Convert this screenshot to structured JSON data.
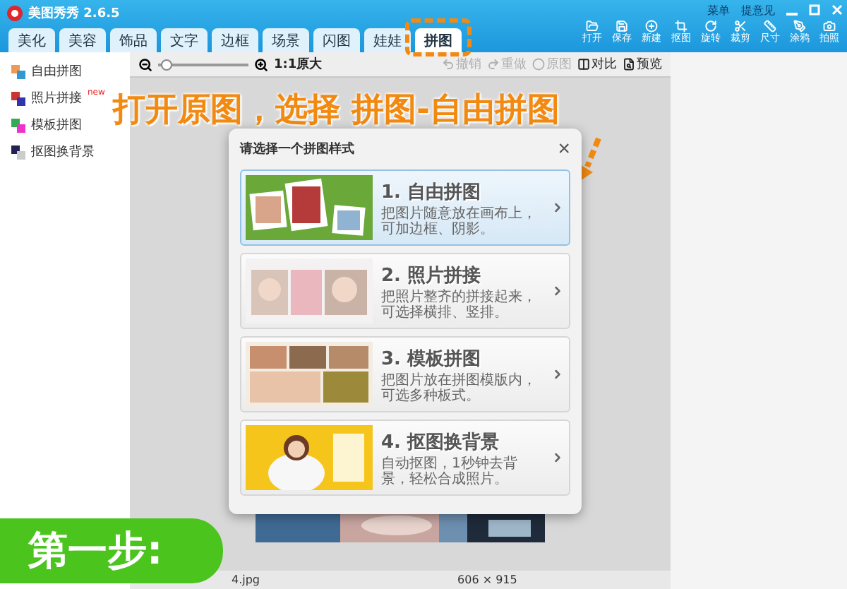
{
  "app": {
    "title": "美图秀秀 2.6.5",
    "links": [
      "菜单",
      "提意见"
    ]
  },
  "tabs": [
    {
      "label": "美化",
      "selected": false
    },
    {
      "label": "美容",
      "selected": false
    },
    {
      "label": "饰品",
      "selected": false
    },
    {
      "label": "文字",
      "selected": false
    },
    {
      "label": "边框",
      "selected": false
    },
    {
      "label": "场景",
      "selected": false
    },
    {
      "label": "闪图",
      "selected": false
    },
    {
      "label": "娃娃",
      "selected": false
    },
    {
      "label": "拼图",
      "selected": true
    }
  ],
  "tools": [
    "打开",
    "保存",
    "新建",
    "抠图",
    "旋转",
    "裁剪",
    "尺寸",
    "涂鸦",
    "拍照"
  ],
  "sidebar": [
    {
      "label": "自由拼图"
    },
    {
      "label": "照片拼接",
      "badge": "new"
    },
    {
      "label": "模板拼图"
    },
    {
      "label": "抠图换背景"
    }
  ],
  "toolbar": {
    "zoom": {
      "level": 0.03
    },
    "zoom_label": "1:1原大",
    "actions": [
      {
        "label": "撤销",
        "disabled": true
      },
      {
        "label": "重做",
        "disabled": true
      },
      {
        "label": "原图",
        "disabled": true
      },
      {
        "label": "对比",
        "disabled": false
      },
      {
        "label": "预览",
        "disabled": false
      }
    ]
  },
  "annotation": "打开原图，选择 拼图-自由拼图",
  "dialog": {
    "title": "请选择一个拼图样式",
    "close": "×",
    "options": [
      {
        "title": "1. 自由拼图",
        "description": "把图片随意放在画布上，可加边框、阴影。",
        "selected": true
      },
      {
        "title": "2. 照片拼接",
        "description": "把照片整齐的拼接起来，可选择横排、竖排。",
        "selected": false
      },
      {
        "title": "3. 模板拼图",
        "description": "把图片放在拼图模版内，可选多种板式。",
        "selected": false
      },
      {
        "title": "4. 抠图换背景",
        "description": "自动抠图，1秒钟去背景，轻松合成照片。",
        "selected": false
      }
    ]
  },
  "status": {
    "file": "4.jpg",
    "size": "606 × 915"
  },
  "step_badge": "第一步:"
}
